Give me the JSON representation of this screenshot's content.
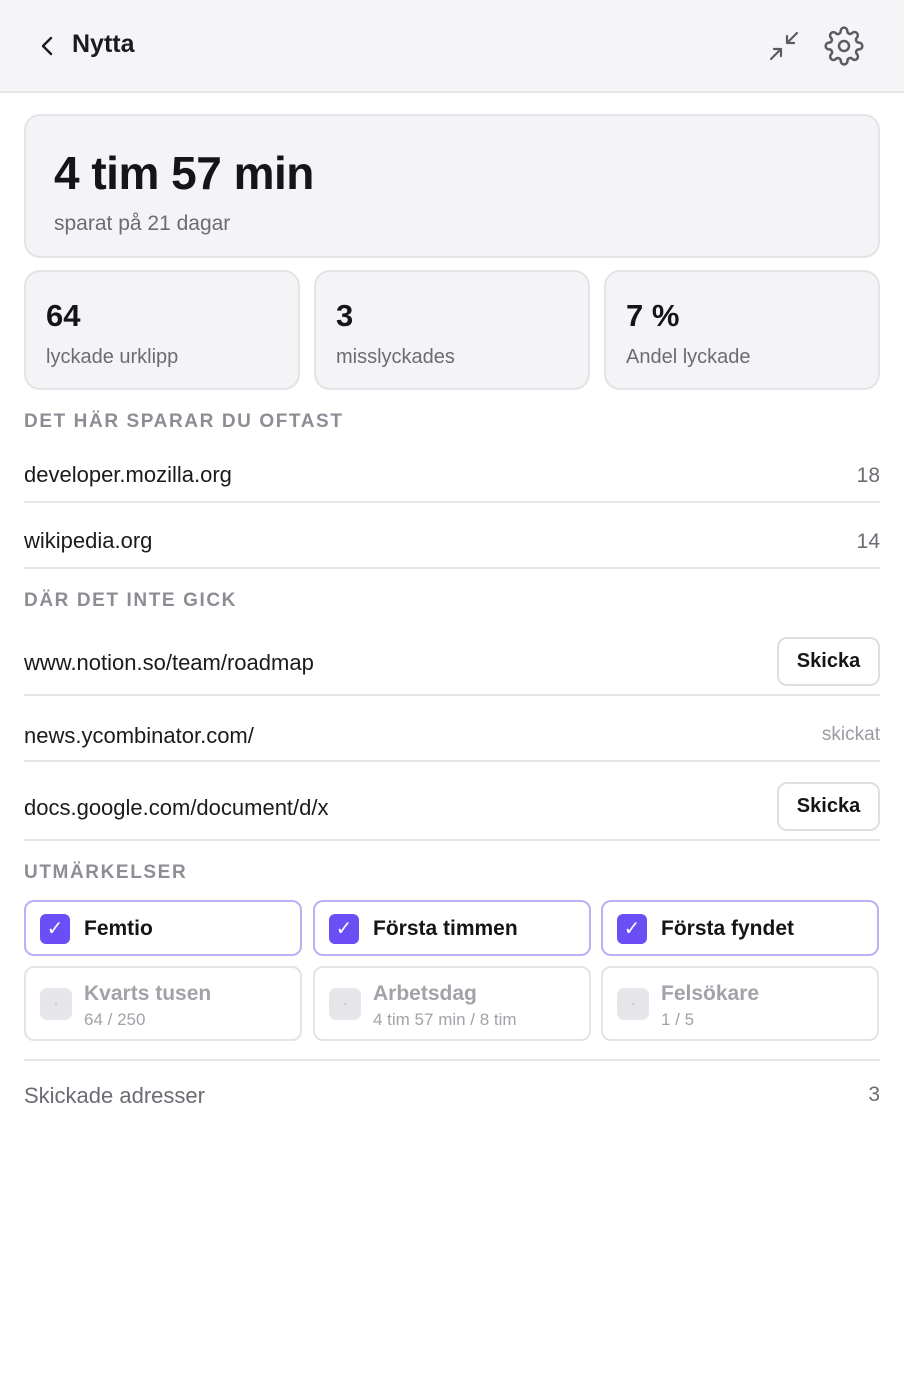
{
  "header": {
    "title": "Nytta",
    "back_icon": "chevron-left-icon",
    "collapse_icon": "collapse-arrows-icon",
    "settings_icon": "gear-icon"
  },
  "hero": {
    "value": "4 tim 57 min",
    "subtitle": "sparat på 21 dagar"
  },
  "stats": [
    {
      "value": "64",
      "label": "lyckade urklipp"
    },
    {
      "value": "3",
      "label": "misslyckades"
    },
    {
      "value": "7 %",
      "label": "Andel lyckade"
    }
  ],
  "top_sites": {
    "heading": "DET HÄR SPARAR DU OFTAST",
    "items": [
      {
        "domain": "developer.mozilla.org",
        "count": "18"
      },
      {
        "domain": "wikipedia.org",
        "count": "14"
      }
    ]
  },
  "failures": {
    "heading": "DÄR DET INTE GICK",
    "send_label": "Skicka",
    "sent_label": "skickat",
    "items": [
      {
        "url": "www.notion.so/team/roadmap",
        "sent": false
      },
      {
        "url": "news.ycombinator.com/",
        "sent": true
      },
      {
        "url": "docs.google.com/document/d/x",
        "sent": false
      }
    ]
  },
  "badges": {
    "heading": "UTMÄRKELSER",
    "check_glyph": "✓",
    "lock_glyph": "·",
    "earned": [
      {
        "name": "Femtio"
      },
      {
        "name": "Första timmen"
      },
      {
        "name": "Första fyndet"
      }
    ],
    "locked": [
      {
        "name": "Kvarts tusen",
        "progress": "64 / 250"
      },
      {
        "name": "Arbetsdag",
        "progress": "4 tim 57 min / 8 tim"
      },
      {
        "name": "Felsökare",
        "progress": "1 / 5"
      }
    ]
  },
  "footer": {
    "label": "Skickade adresser",
    "count": "3"
  },
  "colors": {
    "accent": "#6b4ef5",
    "accent_border": "#b9b0f5",
    "card_bg": "#f4f4f6",
    "muted_text": "#6b6b73"
  }
}
